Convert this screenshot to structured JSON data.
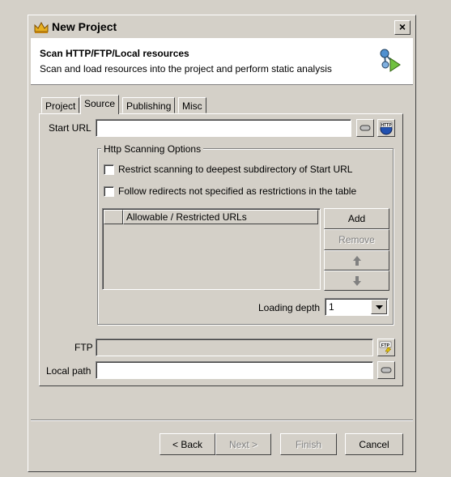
{
  "window": {
    "title": "New Project",
    "close_symbol": "×"
  },
  "header": {
    "title": "Scan HTTP/FTP/Local resources",
    "subtitle": "Scan and load resources into the project and perform static analysis"
  },
  "tabs": [
    {
      "label": "Project",
      "active": false
    },
    {
      "label": "Source",
      "active": true
    },
    {
      "label": "Publishing",
      "active": false
    },
    {
      "label": "Misc",
      "active": false
    }
  ],
  "source": {
    "start_url_label": "Start URL",
    "start_url_value": "",
    "http_group_label": "Http Scanning Options",
    "restrict_label": "Restrict scanning to deepest subdirectory of Start URL",
    "restrict_checked": false,
    "follow_label": "Follow redirects not specified as restrictions in the table",
    "follow_checked": false,
    "table_header": "Allowable / Restricted URLs",
    "table_rows": [],
    "add_label": "Add",
    "remove_label": "Remove",
    "loading_depth_label": "Loading depth",
    "loading_depth_value": "1",
    "ftp_label": "FTP",
    "ftp_value": "",
    "local_path_label": "Local path",
    "local_path_value": ""
  },
  "footer": {
    "back_label": "< Back",
    "next_label": "Next >",
    "finish_label": "Finish",
    "cancel_label": "Cancel"
  },
  "icons": {
    "window": "crown-icon",
    "header": "share-network-icon",
    "browse": "minus-icon",
    "http": "http-globe-icon",
    "ftp": "ftp-icon",
    "up": "arrow-up-icon",
    "down": "arrow-down-icon",
    "combo": "chevron-down-icon"
  }
}
